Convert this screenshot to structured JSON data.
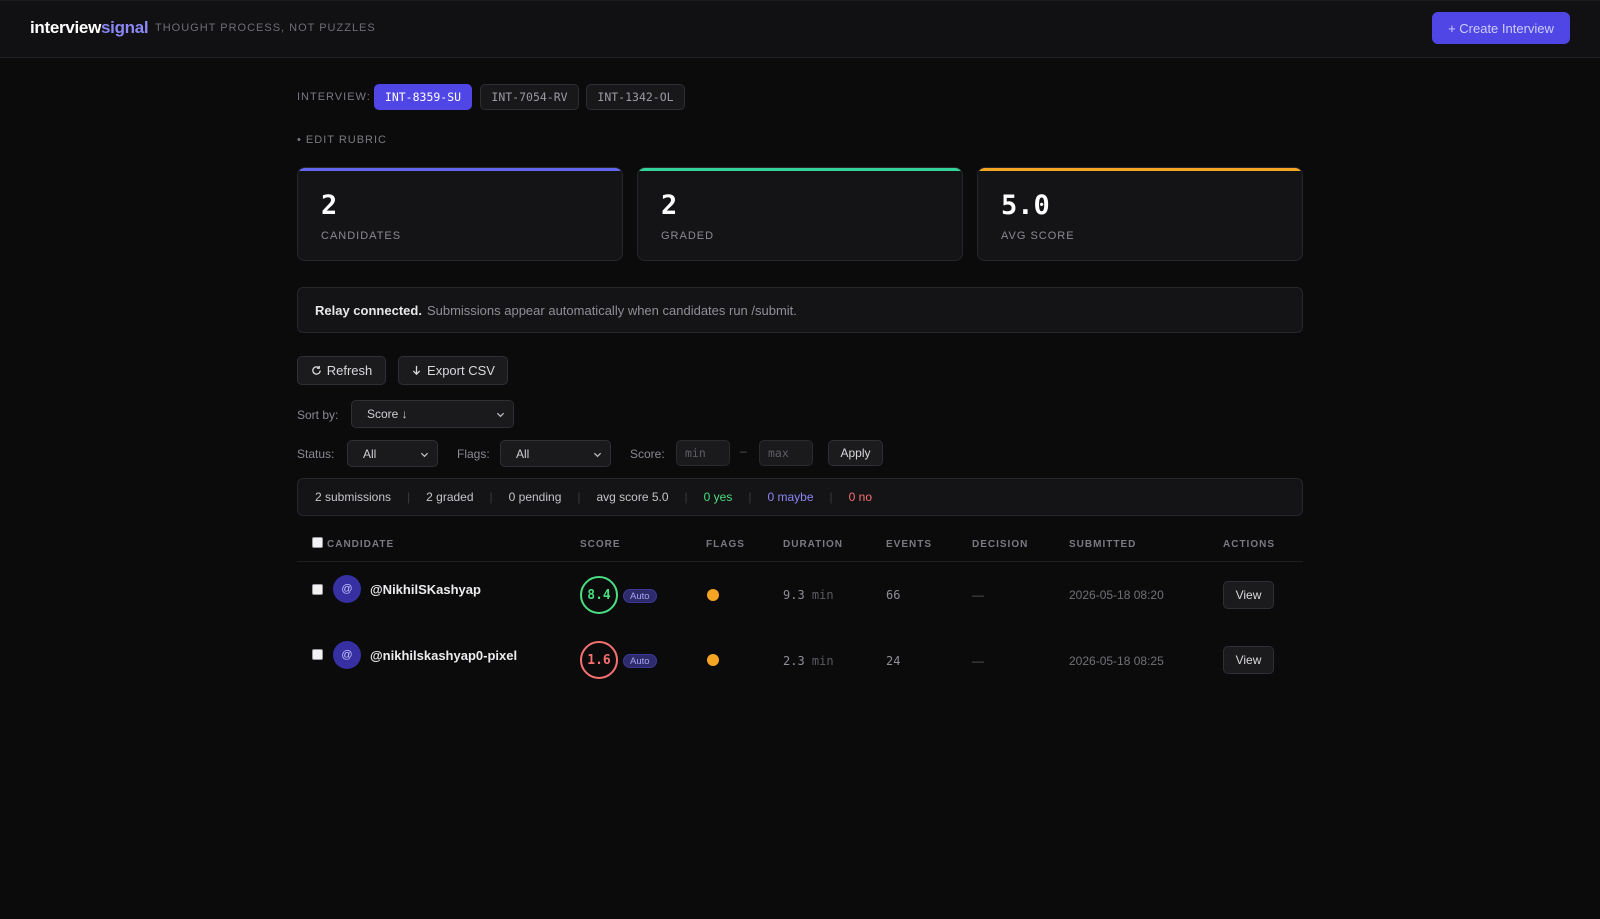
{
  "header": {
    "brand_part1": "interview",
    "brand_part2": "signal",
    "tagline": "THOUGHT PROCESS, NOT PUZZLES",
    "create_button": "+ Create Interview"
  },
  "interview_selector": {
    "label": "INTERVIEW:",
    "tabs": [
      {
        "label": "INT-8359-SU",
        "active": true
      },
      {
        "label": "INT-7054-RV",
        "active": false
      },
      {
        "label": "INT-1342-OL",
        "active": false
      }
    ]
  },
  "edit_rubric": "• EDIT RUBRIC",
  "stats": [
    {
      "value": "2",
      "label": "CANDIDATES",
      "accent": "#6366f1"
    },
    {
      "value": "2",
      "label": "GRADED",
      "accent": "#34d399"
    },
    {
      "value": "5.0",
      "label": "AVG SCORE",
      "accent": "#f5a524"
    }
  ],
  "relay": {
    "strong": "Relay connected.",
    "text": "Submissions appear automatically when candidates run /submit."
  },
  "toolbar": {
    "refresh": "Refresh",
    "export": "Export CSV"
  },
  "sort": {
    "label": "Sort by:",
    "value": "Score ↓"
  },
  "filters": {
    "status_label": "Status:",
    "status_value": "All",
    "flags_label": "Flags:",
    "flags_value": "All",
    "score_label": "Score:",
    "min_placeholder": "min",
    "dash": "–",
    "max_placeholder": "max",
    "apply": "Apply"
  },
  "summary": {
    "submissions": "2 submissions",
    "graded": "2 graded",
    "pending": "0 pending",
    "avg": "avg score 5.0",
    "yes": "0 yes",
    "maybe": "0 maybe",
    "no": "0 no",
    "colors": {
      "yes": "#4ade80",
      "maybe": "#8b87f5",
      "no": "#f87171"
    }
  },
  "table": {
    "columns": [
      "CANDIDATE",
      "SCORE",
      "FLAGS",
      "DURATION",
      "EVENTS",
      "DECISION",
      "SUBMITTED",
      "ACTIONS"
    ],
    "rows": [
      {
        "avatar": "@",
        "handle": "@NikhilSKashyap",
        "score": "8.4",
        "score_color": "#4ade80",
        "badge": "Auto",
        "flag_color": "#f5a524",
        "duration": "9.3",
        "duration_unit": "min",
        "events": "66",
        "decision": "—",
        "submitted": "2026-05-18 08:20",
        "action": "View"
      },
      {
        "avatar": "@",
        "handle": "@nikhilskashyap0-pixel",
        "score": "1.6",
        "score_color": "#f87171",
        "badge": "Auto",
        "flag_color": "#f5a524",
        "duration": "2.3",
        "duration_unit": "min",
        "events": "24",
        "decision": "—",
        "submitted": "2026-05-18 08:25",
        "action": "View"
      }
    ]
  }
}
